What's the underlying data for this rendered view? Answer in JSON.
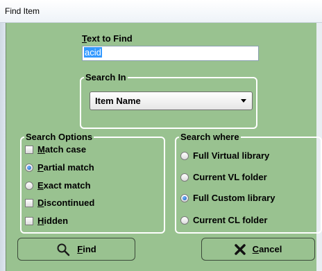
{
  "window": {
    "title": "Find Item"
  },
  "text_to_find": {
    "label_u": "T",
    "label_rest": "ext to Find",
    "value": "acid"
  },
  "search_in": {
    "legend": "Search In",
    "selected": "Item Name"
  },
  "search_options": {
    "legend": "Search Options",
    "items": [
      {
        "type": "checkbox",
        "u": "M",
        "rest": "atch case",
        "checked": false
      },
      {
        "type": "radio",
        "u": "P",
        "rest": "artial match",
        "checked": true
      },
      {
        "type": "radio",
        "u": "E",
        "rest": "xact match",
        "checked": false
      },
      {
        "type": "checkbox",
        "u": "D",
        "rest": "iscontinued",
        "checked": false
      },
      {
        "type": "checkbox",
        "u": "H",
        "rest": "idden",
        "checked": false
      }
    ]
  },
  "search_where": {
    "legend": "Search where",
    "items": [
      {
        "label": "Full Virtual library",
        "checked": false
      },
      {
        "label": "Current VL folder",
        "checked": false
      },
      {
        "label": "Full Custom library",
        "checked": true
      },
      {
        "label": "Current CL folder",
        "checked": false
      }
    ]
  },
  "buttons": {
    "find": {
      "u": "F",
      "rest": "ind",
      "icon": "magnifier-icon"
    },
    "cancel": {
      "u": "C",
      "rest": "ancel",
      "icon": "x-mark-icon"
    }
  }
}
